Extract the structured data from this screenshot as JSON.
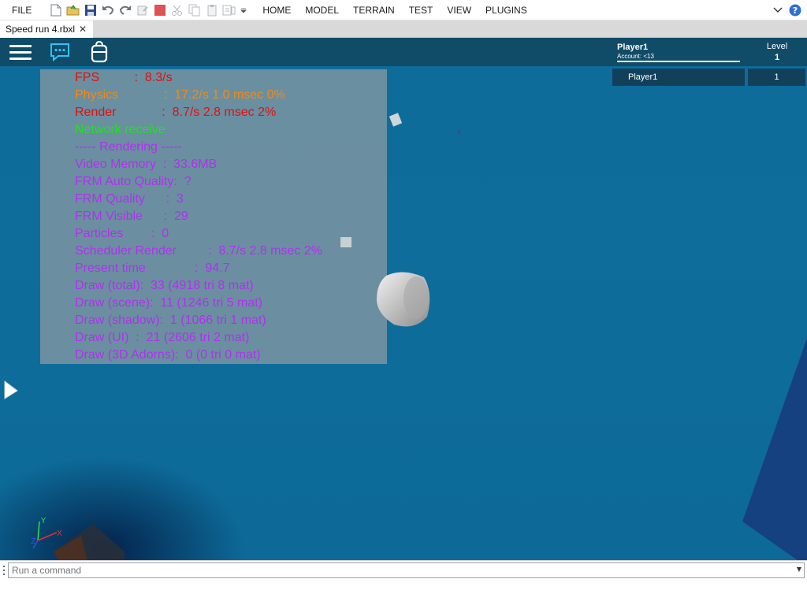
{
  "menu": {
    "file": "FILE",
    "tabs": [
      "HOME",
      "MODEL",
      "TERRAIN",
      "TEST",
      "VIEW",
      "PLUGINS"
    ]
  },
  "toolbar_icons": [
    "new-file-icon",
    "open-folder-icon",
    "save-icon",
    "undo-icon",
    "redo-icon",
    "publish-icon",
    "stop-icon",
    "cut-icon",
    "copy-icon",
    "paste-icon",
    "duplicate-icon",
    "quick-access-dropdown-icon"
  ],
  "document_tab": {
    "title": "Speed run 4.rbxl",
    "close": "✕"
  },
  "leaderboard": {
    "player_header": "Player1",
    "account": "Account: <13",
    "level_header": "Level",
    "level_header_value": "1",
    "rows": [
      {
        "name": "Player1",
        "level": "1"
      }
    ]
  },
  "stats": [
    {
      "text": "FPS          :  8.3/s",
      "color": "#e01010"
    },
    {
      "text": "Physics             :  17.2/s 1.0 msec 0%",
      "color": "#f08a1a"
    },
    {
      "text": "Render             :  8.7/s 2.8 msec 2%",
      "color": "#e01010"
    },
    {
      "text": "Network receive",
      "color": "#22e022"
    },
    {
      "text": "----- Rendering -----",
      "color": "#b030f0"
    },
    {
      "text": "Video Memory  :  33.6MB",
      "color": "#b030f0"
    },
    {
      "text": "FRM Auto Quality:  ?",
      "color": "#b030f0"
    },
    {
      "text": "FRM Quality      :  3",
      "color": "#b030f0"
    },
    {
      "text": "FRM Visible      :  29",
      "color": "#b030f0"
    },
    {
      "text": "Particles        :  0",
      "color": "#b030f0"
    },
    {
      "text": "Scheduler Render         :  8.7/s 2.8 msec 2%",
      "color": "#b030f0"
    },
    {
      "text": "Present time              :  94.7",
      "color": "#b030f0"
    },
    {
      "text": "Draw (total):  33 (4918 tri 8 mat)",
      "color": "#b030f0"
    },
    {
      "text": "Draw (scene):  11 (1246 tri 5 mat)",
      "color": "#b030f0"
    },
    {
      "text": "Draw (shadow):  1 (1066 tri 1 mat)",
      "color": "#b030f0"
    },
    {
      "text": "Draw (UI)  :  21 (2606 tri 2 mat)",
      "color": "#b030f0"
    },
    {
      "text": "Draw (3D Adorns):  0 (0 tri 0 mat)",
      "color": "#b030f0"
    }
  ],
  "axes": {
    "x": "X",
    "y": "Y",
    "z": "Z"
  },
  "command_bar": {
    "placeholder": "Run a command"
  }
}
